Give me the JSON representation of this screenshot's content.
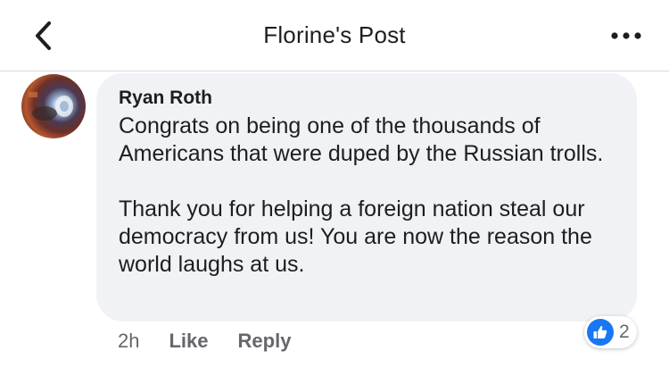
{
  "header": {
    "title": "Florine's Post",
    "back_icon": "chevron-left-icon",
    "more_icon": "more-horizontal-icon"
  },
  "comment": {
    "author": "Ryan Roth",
    "paragraphs": [
      "Congrats on being one of the thousands of Americans that were duped by the Russian trolls.",
      "Thank you for helping a foreign nation steal our democracy from us!  You are now the reason the world laughs at us."
    ],
    "time": "2h",
    "like_label": "Like",
    "reply_label": "Reply",
    "reaction_icon": "thumbs-up-icon",
    "reaction_count": "2"
  },
  "colors": {
    "bubble": "#f0f2f5",
    "like_blue": "#1877f2",
    "meta_gray": "#65676b"
  }
}
